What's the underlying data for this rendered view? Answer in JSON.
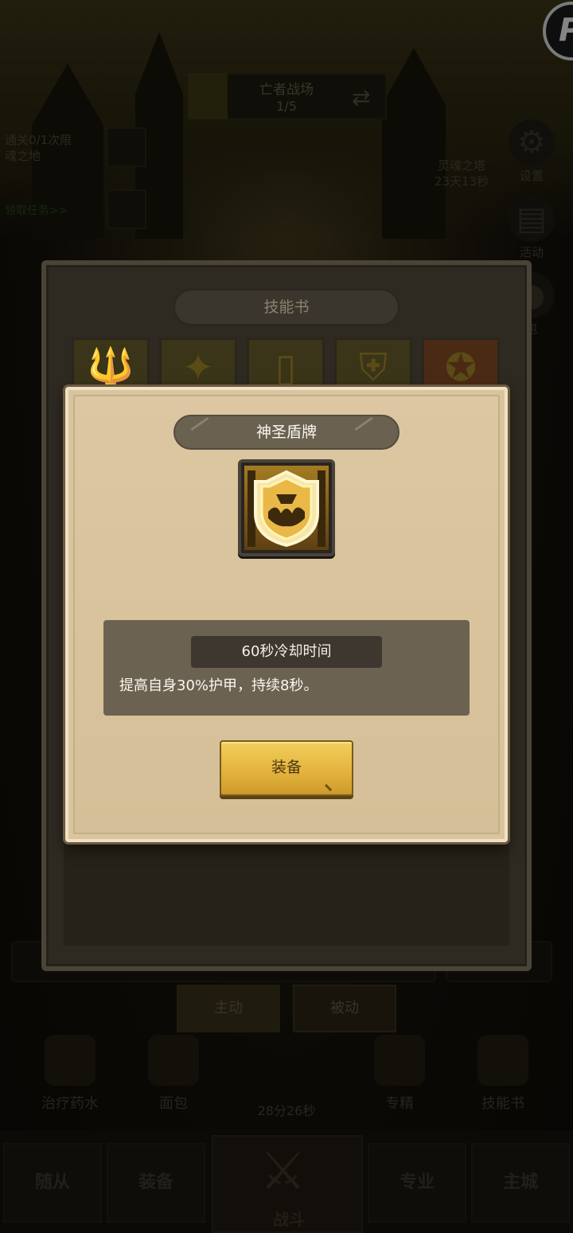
{
  "background": {
    "stage_title": "亡者战场",
    "stage_progress": "1/5",
    "quest_text": [
      "通关0/1次限",
      "魂之地"
    ],
    "quest_link": "领取任务>>",
    "event_text": [
      "灵魂之塔",
      "23天13秒"
    ],
    "side_buttons": [
      {
        "label": "设置",
        "icon": "gear-icon"
      },
      {
        "label": "活动",
        "icon": "calendar-icon"
      },
      {
        "label": "包",
        "icon": "gift-icon"
      }
    ],
    "tabs": [
      {
        "label": "主动",
        "active": true
      },
      {
        "label": "被动",
        "active": false
      }
    ],
    "items": [
      {
        "label": "治疗药水",
        "icon": "potion-icon"
      },
      {
        "label": "面包",
        "icon": "bread-icon"
      },
      {
        "label": "专精",
        "icon": "target-icon"
      },
      {
        "label": "技能书",
        "icon": "book-icon"
      }
    ],
    "timer": "28分26秒",
    "nav": [
      {
        "label": "随从"
      },
      {
        "label": "装备"
      },
      {
        "label": "战斗"
      },
      {
        "label": "专业"
      },
      {
        "label": "主城"
      }
    ]
  },
  "skill_book": {
    "title": "技能书",
    "skills": [
      {
        "icon": "trident-icon"
      },
      {
        "icon": "shatter-icon"
      },
      {
        "icon": "door-icon"
      },
      {
        "icon": "shield-emblem-icon"
      },
      {
        "icon": "winged-helm-icon"
      }
    ]
  },
  "popup": {
    "skill_name": "神圣盾牌",
    "skill_icon": "holy-shield-icon",
    "cooldown": "60秒冷却时间",
    "description": "提高自身30%护甲，持续8秒。",
    "equip_label": "装备"
  },
  "colors": {
    "popup_bg": "#d9c4a0",
    "equip_button": "#e2b23c",
    "title_pill": "#6a6150",
    "desc_box": "#6c6252"
  }
}
